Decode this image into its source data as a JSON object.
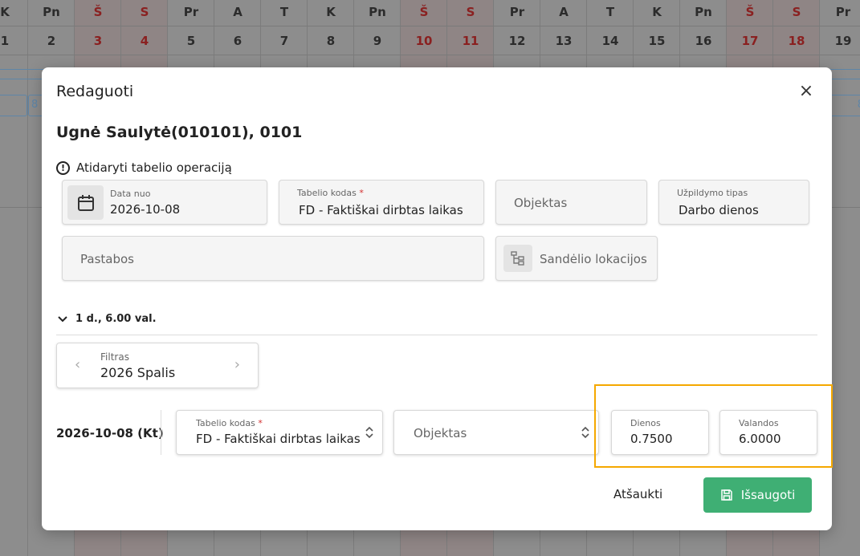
{
  "calendar": {
    "days": [
      {
        "wd": "K",
        "num": "1",
        "weekend": false
      },
      {
        "wd": "Pn",
        "num": "2",
        "weekend": false
      },
      {
        "wd": "Š",
        "num": "3",
        "weekend": true
      },
      {
        "wd": "S",
        "num": "4",
        "weekend": true
      },
      {
        "wd": "Pr",
        "num": "5",
        "weekend": false
      },
      {
        "wd": "A",
        "num": "6",
        "weekend": false
      },
      {
        "wd": "T",
        "num": "7",
        "weekend": false
      },
      {
        "wd": "K",
        "num": "8",
        "weekend": false
      },
      {
        "wd": "Pn",
        "num": "9",
        "weekend": false
      },
      {
        "wd": "Š",
        "num": "10",
        "weekend": true
      },
      {
        "wd": "S",
        "num": "11",
        "weekend": true
      },
      {
        "wd": "Pr",
        "num": "12",
        "weekend": false
      },
      {
        "wd": "A",
        "num": "13",
        "weekend": false
      },
      {
        "wd": "T",
        "num": "14",
        "weekend": false
      },
      {
        "wd": "K",
        "num": "15",
        "weekend": false
      },
      {
        "wd": "Pn",
        "num": "16",
        "weekend": false
      },
      {
        "wd": "Š",
        "num": "17",
        "weekend": true
      },
      {
        "wd": "S",
        "num": "18",
        "weekend": true
      },
      {
        "wd": "Pr",
        "num": "19",
        "weekend": false
      }
    ],
    "cell_left": "8",
    "cell_right": "8"
  },
  "modal": {
    "title": "Redaguoti",
    "person": "Ugnė Saulytė(010101), 0101",
    "open_operation": "Atidaryti tabelio operaciją",
    "date_from": {
      "label": "Data nuo",
      "value": "2026-10-08"
    },
    "tabelio_kodas": {
      "label": "Tabelio kodas",
      "required_mark": "*",
      "value": "FD - Faktiškai dirbtas laikas"
    },
    "objektas": {
      "placeholder": "Objektas"
    },
    "uzpildymo_tipas": {
      "label": "Užpildymo tipas",
      "value": "Darbo dienos"
    },
    "pastabos": {
      "placeholder": "Pastabos"
    },
    "sandelio": {
      "placeholder": "Sandėlio lokacijos"
    },
    "summary": "1 d., 6.00 val.",
    "filter": {
      "label": "Filtras",
      "value": "2026 Spalis"
    },
    "row": {
      "date": "2026-10-08 (Kt)",
      "tabelio_kodas": {
        "label": "Tabelio kodas",
        "required_mark": "*",
        "value": "FD - Faktiškai dirbtas laikas"
      },
      "objektas": {
        "placeholder": "Objektas"
      },
      "dienos": {
        "label": "Dienos",
        "value": "0.7500"
      },
      "valandos": {
        "label": "Valandos",
        "value": "6.0000"
      }
    },
    "cancel_label": "Atšaukti",
    "save_label": "Išsaugoti"
  },
  "colors": {
    "save": "#3faf74",
    "highlight": "#f5a800",
    "required": "#d32f2f"
  }
}
